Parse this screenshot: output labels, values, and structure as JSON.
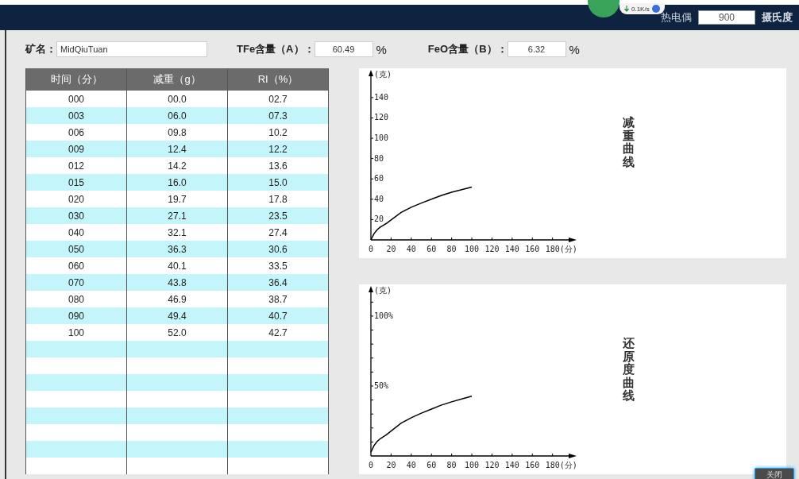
{
  "top_bar": {
    "thermocouple_label": "热电偶",
    "thermocouple_value": "900",
    "unit": "摄氏度"
  },
  "speed_widget": {
    "speed": "0.1K/s"
  },
  "form": {
    "ore_label": "矿名：",
    "ore_value": "MidQiuTuan",
    "tfe_label": "TFe含量（A）：",
    "tfe_value": "60.49",
    "tfe_unit": "%",
    "feo_label": "FeO含量（B）：",
    "feo_value": "6.32",
    "feo_unit": "%"
  },
  "table": {
    "columns": [
      "时间（分）",
      "减重（g）",
      "RI（%）"
    ],
    "rows": [
      [
        "000",
        "00.0",
        "02.7"
      ],
      [
        "003",
        "06.0",
        "07.3"
      ],
      [
        "006",
        "09.8",
        "10.2"
      ],
      [
        "009",
        "12.4",
        "12.2"
      ],
      [
        "012",
        "14.2",
        "13.6"
      ],
      [
        "015",
        "16.0",
        "15.0"
      ],
      [
        "020",
        "19.7",
        "17.8"
      ],
      [
        "030",
        "27.1",
        "23.5"
      ],
      [
        "040",
        "32.1",
        "27.4"
      ],
      [
        "050",
        "36.3",
        "30.6"
      ],
      [
        "060",
        "40.1",
        "33.5"
      ],
      [
        "070",
        "43.8",
        "36.4"
      ],
      [
        "080",
        "46.9",
        "38.7"
      ],
      [
        "090",
        "49.4",
        "40.7"
      ],
      [
        "100",
        "52.0",
        "42.7"
      ]
    ]
  },
  "charts": [
    {
      "title": "减重曲线",
      "chart_data": {
        "type": "line",
        "ylabel": "(克)",
        "x": [
          0,
          3,
          6,
          9,
          12,
          15,
          20,
          30,
          40,
          50,
          60,
          70,
          80,
          90,
          100
        ],
        "series": [
          {
            "color": "#000000",
            "values": [
              0,
              6.0,
              9.8,
              12.4,
              14.2,
              16.0,
              19.7,
              27.1,
              32.1,
              36.3,
              40.1,
              43.8,
              46.9,
              49.4,
              52.0
            ]
          }
        ],
        "xlim": [
          0,
          196
        ],
        "ylim": [
          0,
          161
        ],
        "xticks": [
          0,
          20,
          40,
          60,
          80,
          100,
          120,
          140,
          160,
          {
            "value": 180,
            "label": "180(分)"
          }
        ],
        "yticks": [
          20,
          40,
          60,
          80,
          100,
          120,
          140
        ]
      }
    },
    {
      "title": "还原度曲线",
      "chart_data": {
        "type": "line",
        "ylabel": "(克)",
        "x": [
          0,
          3,
          6,
          9,
          12,
          15,
          20,
          30,
          40,
          50,
          60,
          70,
          80,
          90,
          100
        ],
        "series": [
          {
            "color": "#000000",
            "values": [
              2.7,
              7.3,
              10.2,
              12.2,
              13.6,
              15.0,
              17.8,
              23.5,
              27.4,
              30.6,
              33.5,
              36.4,
              38.7,
              40.7,
              42.7
            ]
          }
        ],
        "xlim": [
          0,
          196
        ],
        "ylim": [
          0,
          117
        ],
        "xticks": [
          0,
          20,
          40,
          60,
          80,
          100,
          120,
          140,
          160,
          {
            "value": 180,
            "label": "180(分)"
          }
        ],
        "yticks": [
          {
            "value": 50,
            "label": "50%"
          },
          {
            "value": 100,
            "label": "100%"
          }
        ]
      }
    }
  ],
  "close_button": "关闭"
}
